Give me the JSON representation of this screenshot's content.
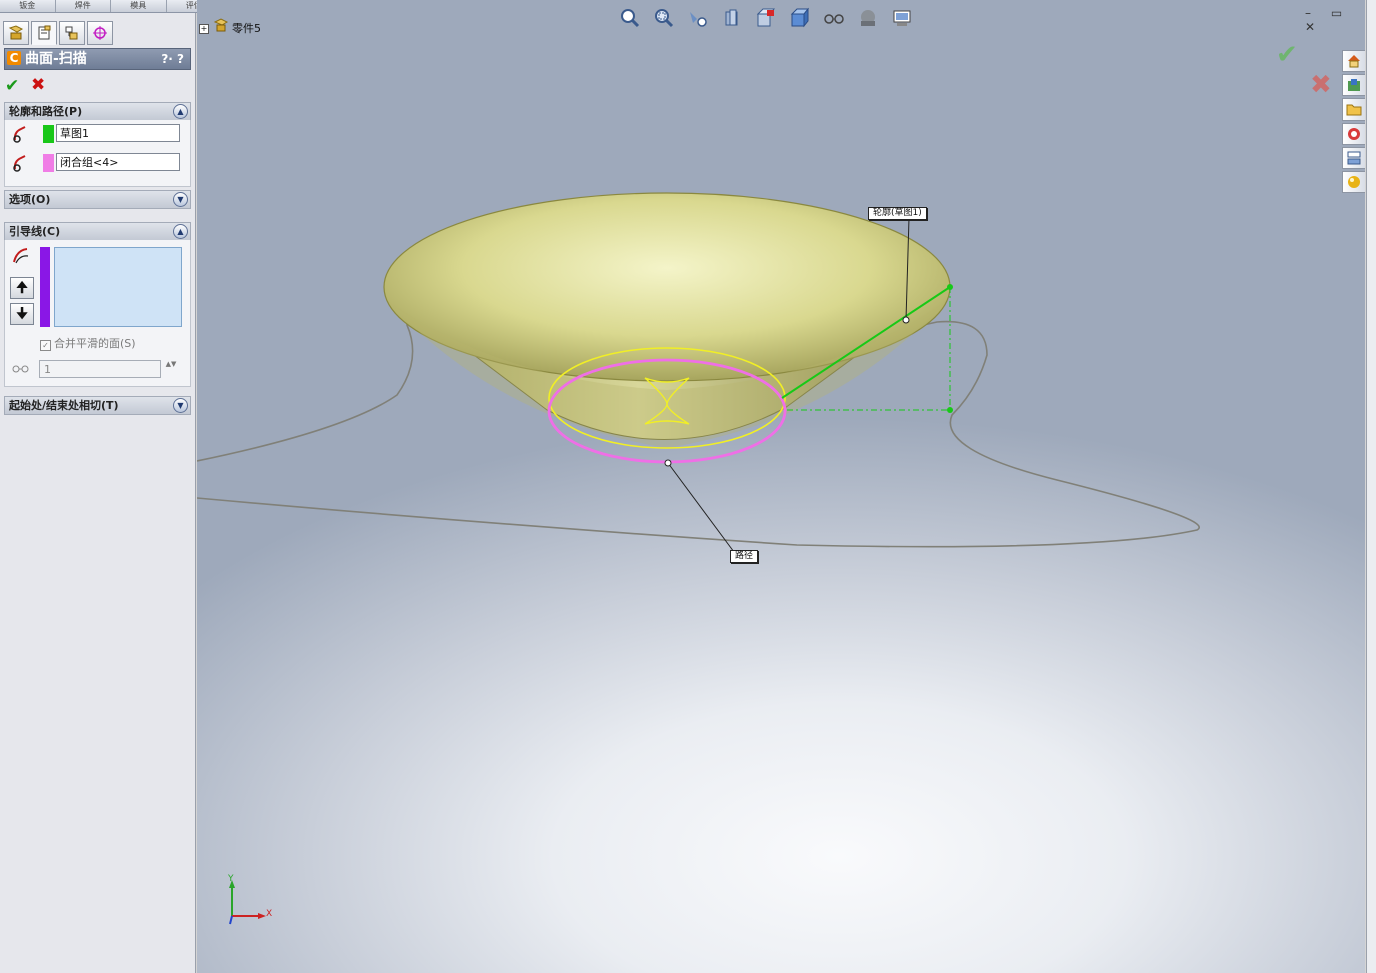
{
  "command_tabs": [
    "钣金",
    "焊件",
    "模具",
    "评估"
  ],
  "manager_tabs": [
    {
      "name": "feature-manager-icon"
    },
    {
      "name": "property-manager-icon"
    },
    {
      "name": "configuration-manager-icon"
    },
    {
      "name": "dim-xpert-icon"
    }
  ],
  "property_manager": {
    "title": "曲面-扫描",
    "help": "?· ?",
    "ok": "✔",
    "cancel": "✖",
    "groups": {
      "profile_path": {
        "label": "轮廓和路径(P)",
        "profile_value": "草图1",
        "profile_color": "#19c719",
        "path_value": "闭合组<4>",
        "path_color": "#f07de6"
      },
      "options": {
        "label": "选项(O)"
      },
      "guide_curves": {
        "label": "引导线(C)",
        "swatch_color": "#8a17e6",
        "up": "🠉",
        "down": "🠋",
        "merge_faces_label": "合并平滑的面(S)",
        "merge_faces_checked": "✓",
        "sections_value": "1",
        "spin": "▲▼"
      },
      "tangency": {
        "label": "起始处/结束处相切(T)"
      }
    }
  },
  "viewport": {
    "tree_node": "零件5",
    "tree_expand": "+",
    "window_controls": "– ▭ ✕",
    "confirm_check": "✔",
    "confirm_x": "✖",
    "callout_profile": "轮廓(草图1)",
    "callout_path": "路径",
    "triad_y": "Y",
    "triad_x": "X"
  },
  "heads_up": [
    "zoom-to-fit-icon",
    "zoom-to-area-icon",
    "previous-view-icon",
    "section-view-icon",
    "view-orientation-icon",
    "display-style-icon",
    "hide-show-items-icon",
    "edit-appearance-icon",
    "apply-scene-icon"
  ],
  "task_pane": [
    "home-icon",
    "design-library-icon",
    "file-explorer-icon",
    "search-icon",
    "view-palette-icon",
    "appearances-icon"
  ]
}
